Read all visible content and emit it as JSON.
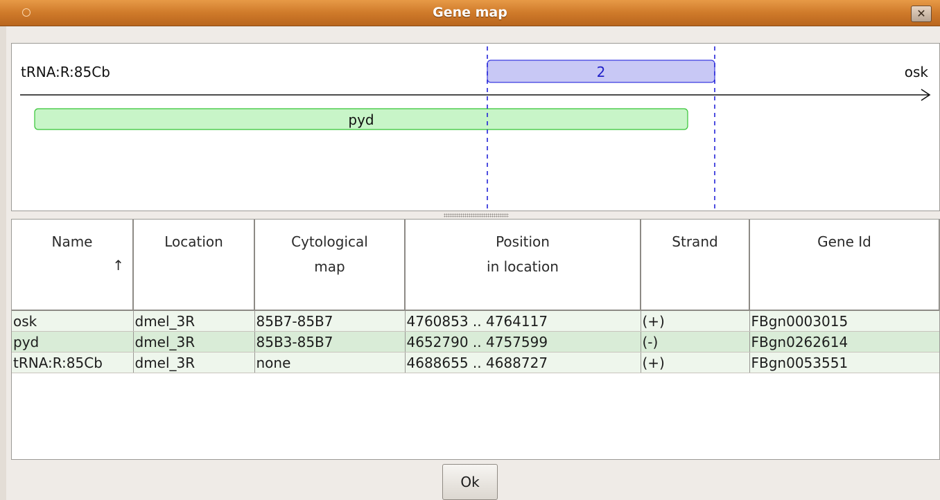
{
  "window": {
    "title": "Gene map"
  },
  "map": {
    "left_label": "tRNA:R:85Cb",
    "right_label": "osk",
    "region_label": "2",
    "gene_label": "pyd",
    "region_color": "#c8c8f5",
    "gene_color": "#c8f5c8"
  },
  "table": {
    "columns": [
      {
        "line1": "Name",
        "line2": ""
      },
      {
        "line1": "Location",
        "line2": ""
      },
      {
        "line1": "Cytological",
        "line2": "map"
      },
      {
        "line1": "Position",
        "line2": "in location"
      },
      {
        "line1": "Strand",
        "line2": ""
      },
      {
        "line1": "Gene Id",
        "line2": ""
      }
    ],
    "sort_indicator": "↑",
    "rows": [
      {
        "name": "osk",
        "location": "dmel_3R",
        "cyto": "85B7-85B7",
        "position": "4760853 .. 4764117",
        "strand": "(+)",
        "gene_id": "FBgn0003015"
      },
      {
        "name": "pyd",
        "location": "dmel_3R",
        "cyto": "85B3-85B7",
        "position": "4652790 .. 4757599",
        "strand": "(-)",
        "gene_id": "FBgn0262614"
      },
      {
        "name": "tRNA:R:85Cb",
        "location": "dmel_3R",
        "cyto": "none",
        "position": "4688655 .. 4688727",
        "strand": "(+)",
        "gene_id": "FBgn0053551"
      }
    ]
  },
  "buttons": {
    "ok": "Ok",
    "close": "✕"
  }
}
